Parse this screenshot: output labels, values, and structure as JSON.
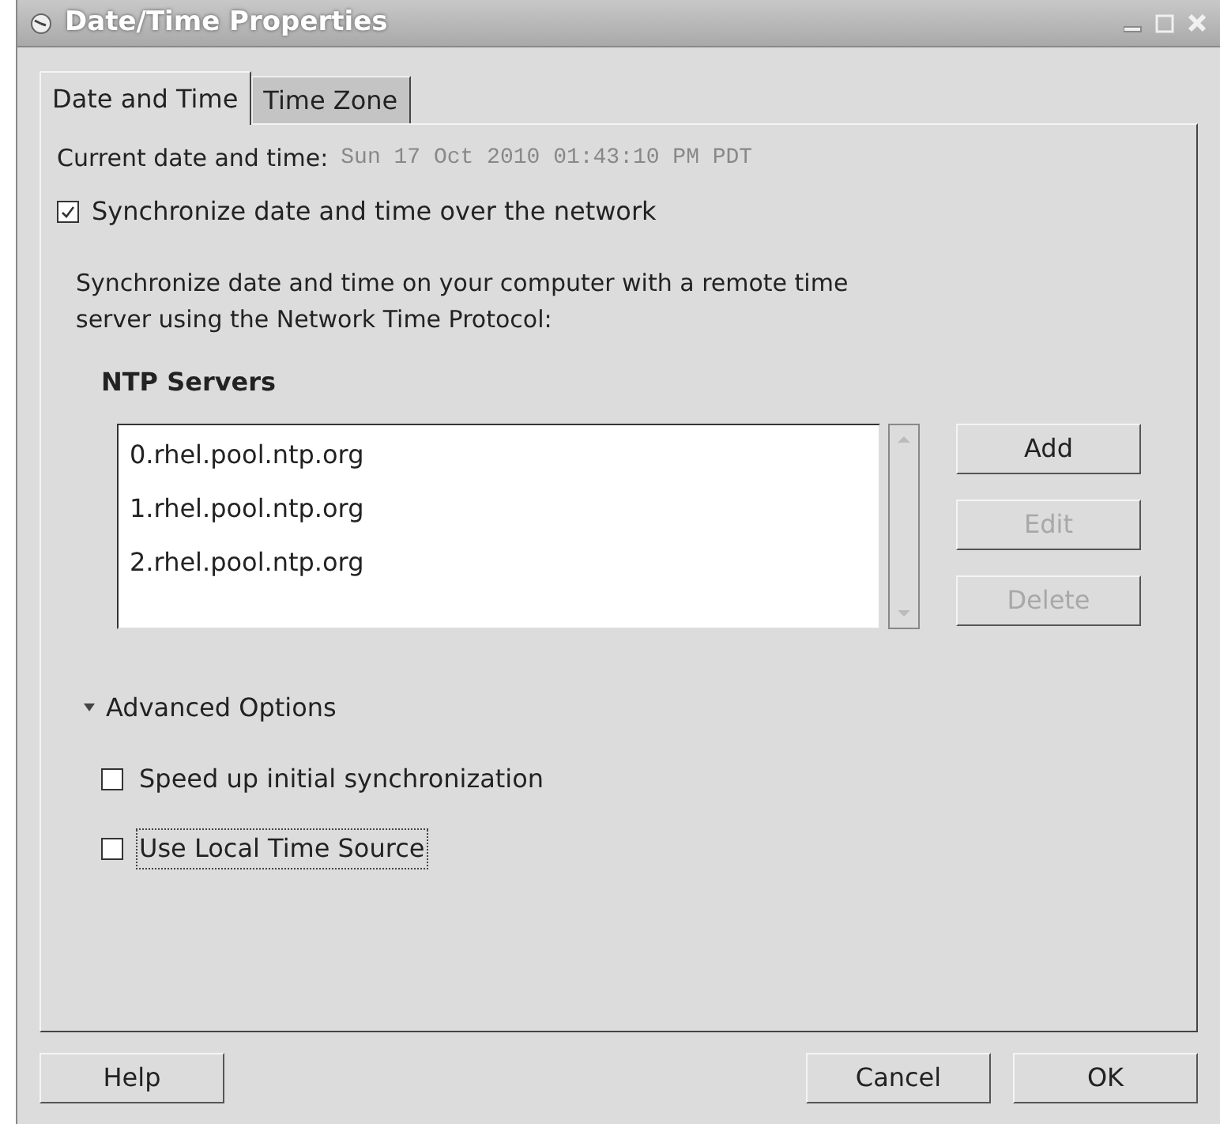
{
  "window": {
    "title": "Date/Time Properties"
  },
  "tabs": [
    {
      "label": "Date and Time",
      "selected": true
    },
    {
      "label": "Time Zone",
      "selected": false
    }
  ],
  "current": {
    "label": "Current date and time:",
    "value": "Sun 17 Oct 2010 01:43:10 PM PDT"
  },
  "sync": {
    "label": "Synchronize date and time over the network",
    "checked": true
  },
  "description": "Synchronize date and time on your computer with a remote time server using the Network Time Protocol:",
  "ntp": {
    "heading": "NTP Servers",
    "servers": [
      "0.rhel.pool.ntp.org",
      "1.rhel.pool.ntp.org",
      "2.rhel.pool.ntp.org"
    ],
    "buttons": [
      {
        "label": "Add",
        "disabled": false
      },
      {
        "label": "Edit",
        "disabled": true
      },
      {
        "label": "Delete",
        "disabled": true
      }
    ]
  },
  "advanced": {
    "label": "Advanced Options",
    "expanded": true,
    "options": [
      {
        "label": "Speed up initial synchronization",
        "checked": false,
        "focused": false
      },
      {
        "label": "Use Local Time Source",
        "checked": false,
        "focused": true
      }
    ]
  },
  "footer": {
    "left": [
      "Help"
    ],
    "right": [
      "Cancel",
      "OK"
    ]
  }
}
